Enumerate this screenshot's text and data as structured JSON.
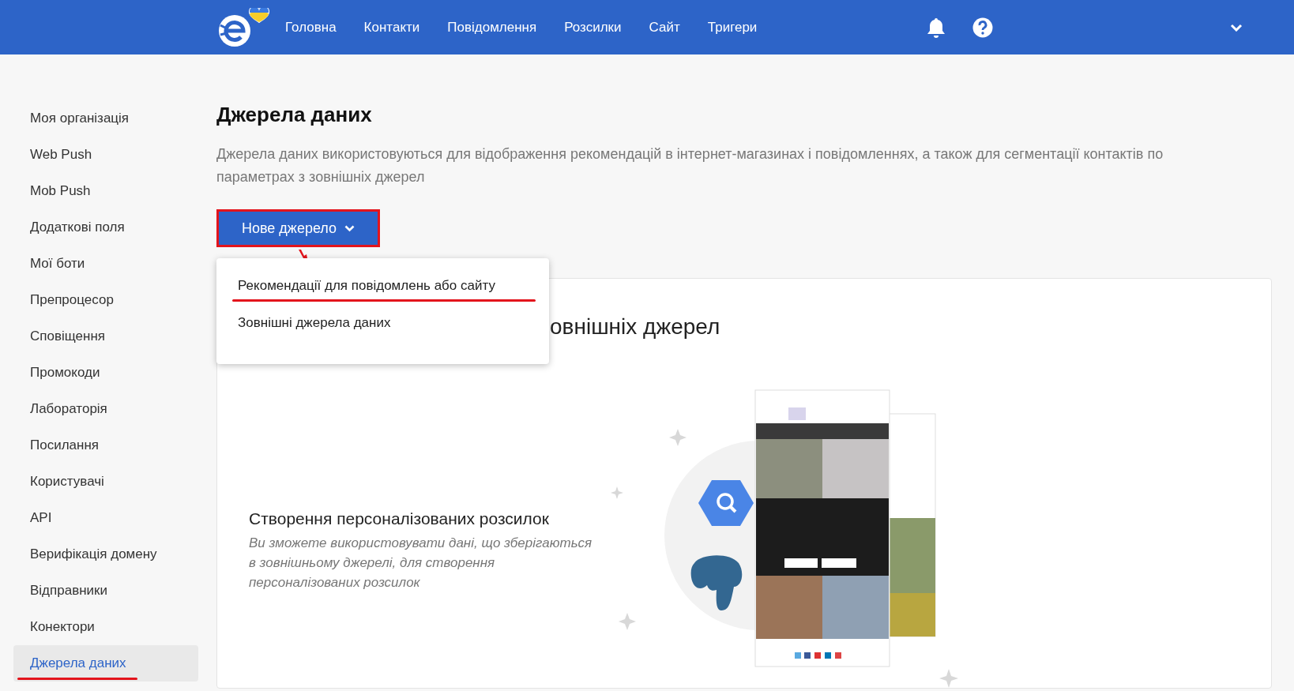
{
  "header": {
    "nav": [
      {
        "label": "Головна"
      },
      {
        "label": "Контакти"
      },
      {
        "label": "Повідомлення"
      },
      {
        "label": "Розсилки"
      },
      {
        "label": "Сайт"
      },
      {
        "label": "Тригери"
      }
    ]
  },
  "sidebar": {
    "items": [
      {
        "label": "Моя організація",
        "selected": false,
        "highlighted": false
      },
      {
        "label": "Web Push",
        "selected": false,
        "highlighted": false
      },
      {
        "label": "Mob Push",
        "selected": false,
        "highlighted": false
      },
      {
        "label": "Додаткові поля",
        "selected": false,
        "highlighted": false
      },
      {
        "label": "Мої боти",
        "selected": false,
        "highlighted": false
      },
      {
        "label": "Препроцесор",
        "selected": false,
        "highlighted": false
      },
      {
        "label": "Сповіщення",
        "selected": false,
        "highlighted": false
      },
      {
        "label": "Промокоди",
        "selected": false,
        "highlighted": false
      },
      {
        "label": "Лабораторія",
        "selected": false,
        "highlighted": false
      },
      {
        "label": "Посилання",
        "selected": false,
        "highlighted": false
      },
      {
        "label": "Користувачі",
        "selected": false,
        "highlighted": false
      },
      {
        "label": "API",
        "selected": false,
        "highlighted": false
      },
      {
        "label": "Верифікація домену",
        "selected": false,
        "highlighted": false
      },
      {
        "label": "Відправники",
        "selected": false,
        "highlighted": false
      },
      {
        "label": "Конектори",
        "selected": false,
        "highlighted": false
      },
      {
        "label": "Джерела даних",
        "selected": true,
        "highlighted": true
      }
    ]
  },
  "page": {
    "title": "Джерела даних",
    "description": "Джерела даних використовуються для відображення рекомендацій в інтернет-магазинах і повідомленнях, а також для сегментації контактів по параметрах з зовнішніх джерел",
    "new_source_button": {
      "label": "Нове джерело",
      "highlighted": true
    },
    "dropdown": {
      "items": [
        {
          "label": "Рекомендації для повідомлень або сайту",
          "highlighted": true
        },
        {
          "label": "Зовнішні джерела даних",
          "highlighted": false
        }
      ]
    }
  },
  "card": {
    "heading": "овнішніх джерел",
    "feature": {
      "title": "Створення персоналізованих розсилок",
      "text": "Ви зможете використовувати дані, що зберігаються в зовнішньому джерелі, для створення персоналізованих розсилок"
    }
  }
}
